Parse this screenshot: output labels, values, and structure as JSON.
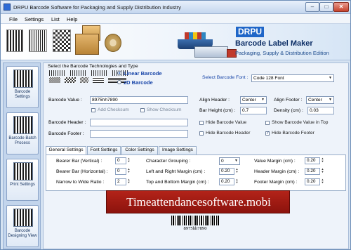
{
  "window": {
    "title": "DRPU Barcode Software for Packaging and Supply Distribution Industry",
    "min_symbol": "–",
    "max_symbol": "□",
    "close_symbol": "✕"
  },
  "menu": {
    "items": [
      "File",
      "Settings",
      "List",
      "Help"
    ]
  },
  "banner": {
    "brand": "DRPU",
    "title": "Barcode Label Maker",
    "subtitle": "Packaging, Supply & Distribution Edition"
  },
  "sidebar": {
    "items": [
      {
        "label": "Barcode Settings",
        "icon": "barcode-settings-icon"
      },
      {
        "label": "Barcode Batch Process",
        "icon": "batch-process-icon"
      },
      {
        "label": "Print Settings",
        "icon": "print-settings-icon"
      },
      {
        "label": "Barcode Designing View",
        "icon": "designing-view-icon"
      }
    ]
  },
  "tech": {
    "label": "Select the Barcode Technologies and Type",
    "linear": "Linear Barcode",
    "twod": "2D Barcode",
    "selected": "linear"
  },
  "font": {
    "label": "Select Barcode Font :",
    "value": "Code 128 Font"
  },
  "fields": {
    "value_label": "Barcode Value :",
    "value": "8975hh7890",
    "add_checksum": "Add Checksum",
    "show_checksum": "Show Checksum",
    "header_label": "Barcode Header :",
    "header_value": "",
    "footer_label": "Barcode Footer :",
    "footer_value": ""
  },
  "align": {
    "header_label": "Align Header :",
    "header_value": "Center",
    "footer_label": "Align Footer :",
    "footer_value": "Center",
    "bar_height_label": "Bar Height (cm) :",
    "bar_height_value": "0.7",
    "density_label": "Density (cm) :",
    "density_value": "0.03"
  },
  "checks": {
    "hide_value": {
      "label": "Hide Barcode Value",
      "checked": false
    },
    "show_value_top": {
      "label": "Show Barcode Value in Top",
      "checked": false
    },
    "hide_header": {
      "label": "Hide Barcode Header",
      "checked": false
    },
    "hide_footer": {
      "label": "Hide Barcode Footer",
      "checked": true
    }
  },
  "tabs": [
    "General Settings",
    "Font Settings",
    "Color Settings",
    "Image Settings"
  ],
  "general": {
    "bearer_v_label": "Bearer Bar (Vertical) :",
    "bearer_v_value": "0",
    "bearer_h_label": "Bearer Bar (Horizontal) :",
    "bearer_h_value": "0",
    "narrow_label": "Narrow to Wide Ratio :",
    "narrow_value": "2",
    "char_group_label": "Character Grouping :",
    "char_group_value": "0",
    "lr_margin_label": "Left and Right Margin (cm) :",
    "lr_margin_value": "0.20",
    "tb_margin_label": "Top and Bottom Margin (cm) :",
    "tb_margin_value": "0.20",
    "value_margin_label": "Value Margin (cm) :",
    "value_margin_value": "0.20",
    "header_margin_label": "Header Margin (cm) :",
    "header_margin_value": "0.20",
    "footer_margin_label": "Footer Margin (cm) :",
    "footer_margin_value": "0.20"
  },
  "preview": {
    "overlay_text": "Timeattendancesoftware.mobi",
    "barcode_text": "8975hh7890"
  }
}
